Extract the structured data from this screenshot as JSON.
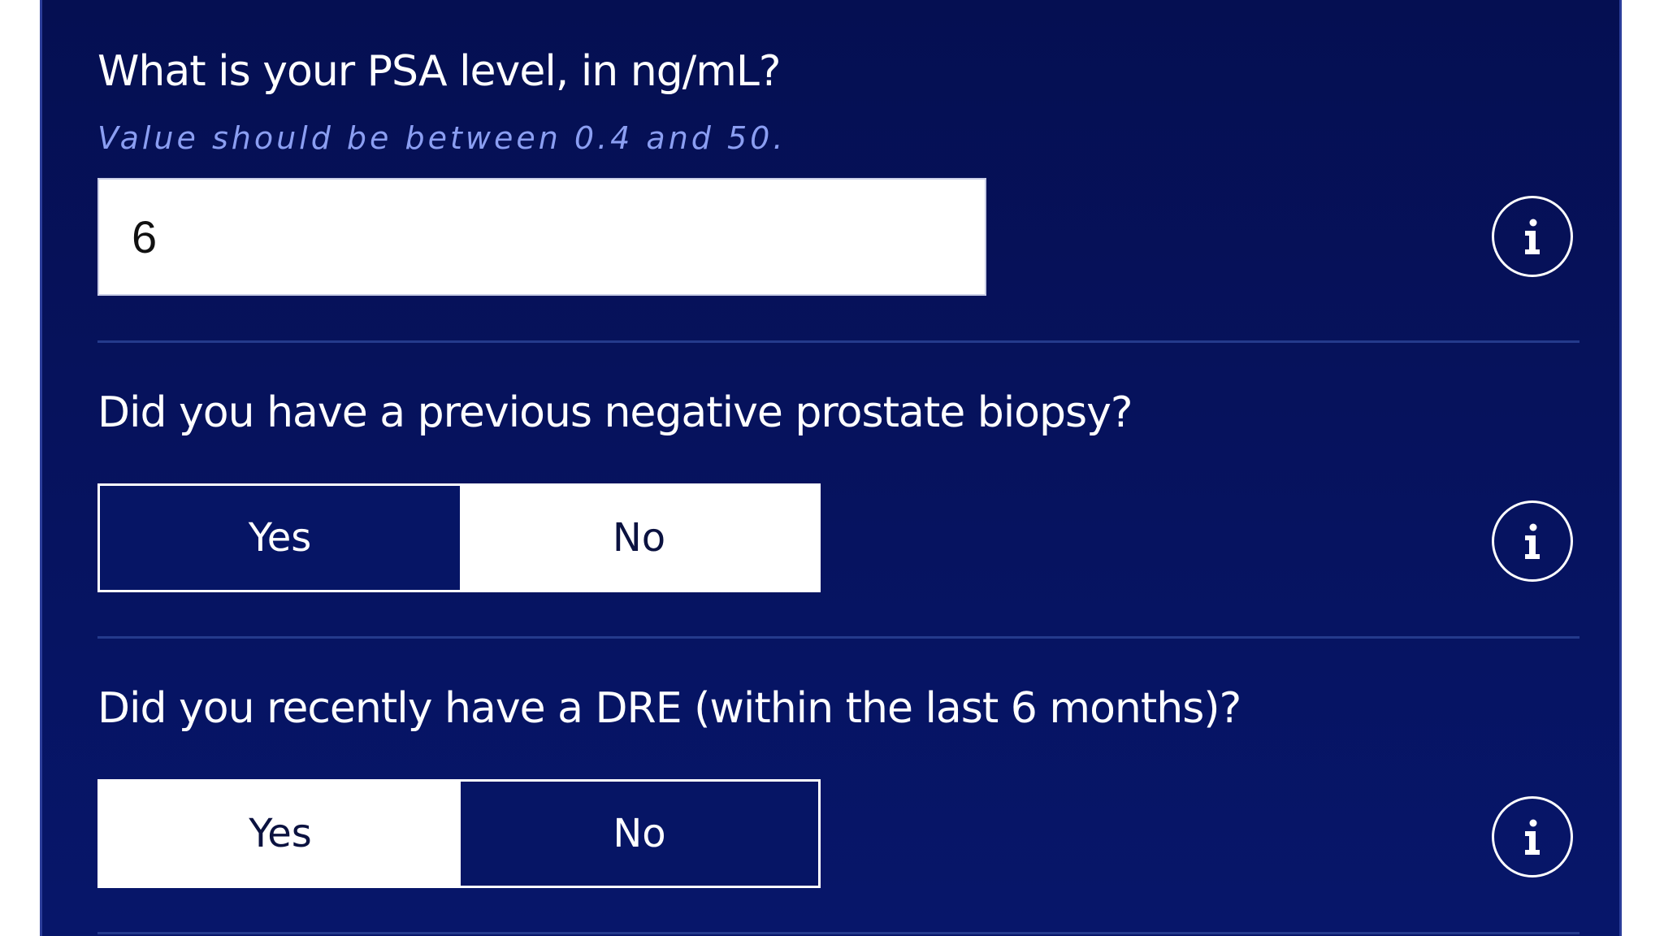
{
  "questions": [
    {
      "label": "What is your PSA level, in ng/mL?",
      "hint": "Value should be between 0.4 and 50.",
      "value": "6",
      "info_icon": "info-icon"
    },
    {
      "label": "Did you have a previous negative prostate biopsy?",
      "options": [
        "Yes",
        "No"
      ],
      "selected": "Yes",
      "info_icon": "info-icon"
    },
    {
      "label": "Did you recently have a DRE (within the last 6 months)?",
      "options": [
        "Yes",
        "No"
      ],
      "selected": "No",
      "info_icon": "info-icon"
    }
  ],
  "colors": {
    "panel_background": "#050f52",
    "selected_option": "#061565",
    "hint_text": "#8b9ef2",
    "divider": "#243a8c"
  }
}
